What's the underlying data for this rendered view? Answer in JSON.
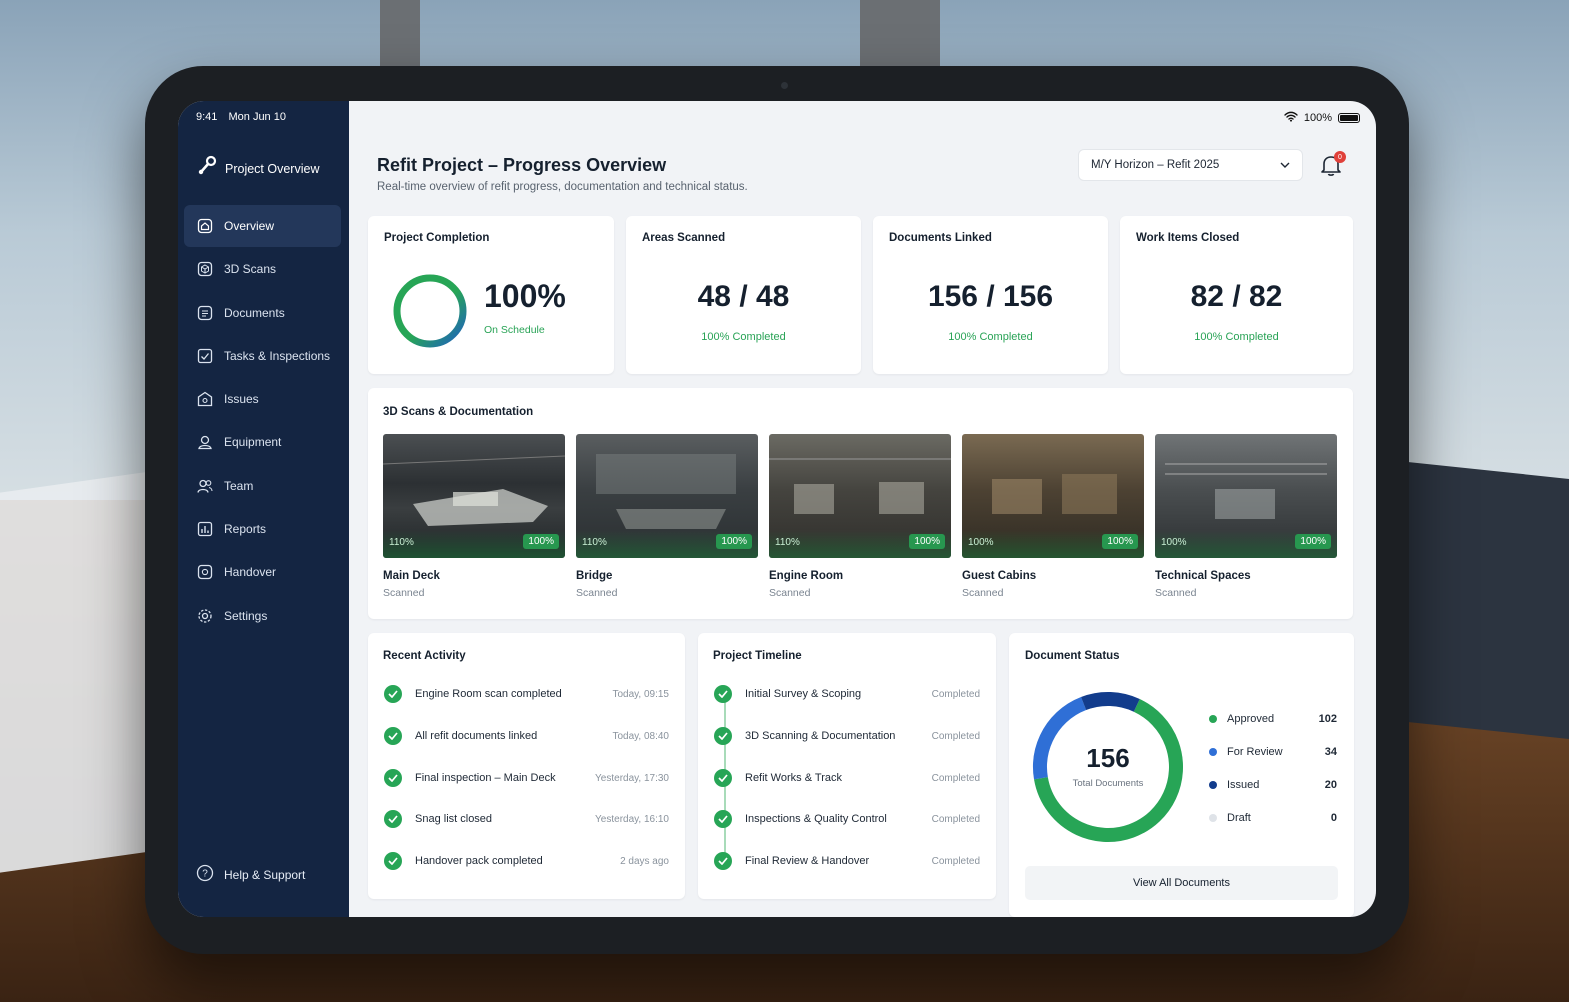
{
  "status_bar": {
    "time": "9:41",
    "date": "Mon Jun 10",
    "battery": "100%"
  },
  "sidebar": {
    "brand": "Project Overview",
    "items": [
      {
        "label": "Overview",
        "icon": "home-icon",
        "active": true
      },
      {
        "label": "3D Scans",
        "icon": "cube-icon",
        "active": false
      },
      {
        "label": "Documents",
        "icon": "document-icon",
        "active": false
      },
      {
        "label": "Tasks & Inspections",
        "icon": "checklist-icon",
        "active": false
      },
      {
        "label": "Issues",
        "icon": "alert-icon",
        "active": false
      },
      {
        "label": "Equipment",
        "icon": "equipment-icon",
        "active": false
      },
      {
        "label": "Team",
        "icon": "team-icon",
        "active": false
      },
      {
        "label": "Reports",
        "icon": "reports-icon",
        "active": false
      },
      {
        "label": "Handover",
        "icon": "handover-icon",
        "active": false
      },
      {
        "label": "Settings",
        "icon": "gear-icon",
        "active": false
      }
    ],
    "help": "Help & Support"
  },
  "header": {
    "title": "Refit Project – Progress Overview",
    "subtitle": "Real-time overview of refit progress, documentation and technical status.",
    "vessel_select": "M/Y Horizon – Refit 2025",
    "notifications": "0"
  },
  "stats": {
    "completion": {
      "title": "Project Completion",
      "value": "100%",
      "sub": "On Schedule",
      "progress": 1.0
    },
    "areas": {
      "title": "Areas Scanned",
      "value": "48 / 48",
      "sub": "100% Completed"
    },
    "documents": {
      "title": "Documents Linked",
      "value": "156 / 156",
      "sub": "100% Completed"
    },
    "work": {
      "title": "Work Items Closed",
      "value": "82 / 82",
      "sub": "100% Completed"
    }
  },
  "scans": {
    "title": "3D Scans & Documentation",
    "items": [
      {
        "name": "Main Deck",
        "status": "Scanned",
        "left_badge": "110%",
        "right_badge": "100%"
      },
      {
        "name": "Bridge",
        "status": "Scanned",
        "left_badge": "110%",
        "right_badge": "100%"
      },
      {
        "name": "Engine Room",
        "status": "Scanned",
        "left_badge": "110%",
        "right_badge": "100%"
      },
      {
        "name": "Guest Cabins",
        "status": "Scanned",
        "left_badge": "100%",
        "right_badge": "100%"
      },
      {
        "name": "Technical Spaces",
        "status": "Scanned",
        "left_badge": "100%",
        "right_badge": "100%"
      }
    ]
  },
  "activity": {
    "title": "Recent Activity",
    "items": [
      {
        "label": "Engine Room scan completed",
        "time": "Today, 09:15"
      },
      {
        "label": "All refit documents linked",
        "time": "Today, 08:40"
      },
      {
        "label": "Final inspection – Main Deck",
        "time": "Yesterday, 17:30"
      },
      {
        "label": "Snag list closed",
        "time": "Yesterday, 16:10"
      },
      {
        "label": "Handover pack completed",
        "time": "2 days ago"
      }
    ]
  },
  "timeline": {
    "title": "Project Timeline",
    "items": [
      {
        "label": "Initial Survey & Scoping",
        "status": "Completed"
      },
      {
        "label": "3D Scanning & Documentation",
        "status": "Completed"
      },
      {
        "label": "Refit Works & Track",
        "status": "Completed"
      },
      {
        "label": "Inspections & Quality Control",
        "status": "Completed"
      },
      {
        "label": "Final Review & Handover",
        "status": "Completed"
      }
    ]
  },
  "doc_status": {
    "title": "Document Status",
    "total": "156",
    "total_label": "Total Documents",
    "legend": [
      {
        "label": "Approved",
        "value": "102",
        "color": "#27a556"
      },
      {
        "label": "For Review",
        "value": "34",
        "color": "#2f6fd6"
      },
      {
        "label": "Issued",
        "value": "20",
        "color": "#123c8c"
      },
      {
        "label": "Draft",
        "value": "0",
        "color": "#dfe3e8"
      }
    ],
    "button": "View All Documents"
  },
  "chart_data": {
    "type": "pie",
    "title": "Document Status",
    "categories": [
      "Approved",
      "For Review",
      "Issued",
      "Draft"
    ],
    "values": [
      102,
      34,
      20,
      0
    ]
  }
}
